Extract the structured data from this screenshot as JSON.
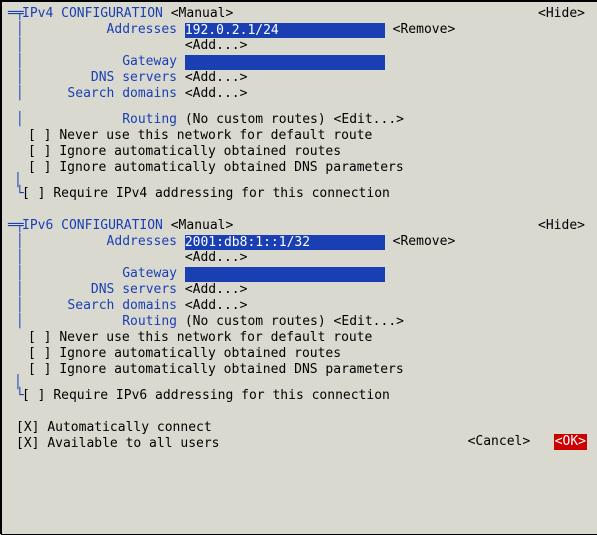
{
  "ipv4": {
    "title": "IPv4 CONFIGURATION",
    "mode": "<Manual>",
    "hide": "<Hide>",
    "addresses_label": "Addresses",
    "address_value": "192.0.2.1/24",
    "remove": "<Remove>",
    "add": "<Add...>",
    "gateway_label": "Gateway",
    "gateway_value": "",
    "dns_label": "DNS servers",
    "search_label": "Search domains",
    "routing_label": "Routing",
    "routing_status": "(No custom routes)",
    "edit": "<Edit...>",
    "cb_never": "Never use this network for default route",
    "cb_ignore_routes": "Ignore automatically obtained routes",
    "cb_ignore_dns": "Ignore automatically obtained DNS parameters",
    "cb_require": "Require IPv4 addressing for this connection"
  },
  "ipv6": {
    "title": "IPv6 CONFIGURATION",
    "mode": "<Manual>",
    "hide": "<Hide>",
    "addresses_label": "Addresses",
    "address_value": "2001:db8:1::1/32",
    "remove": "<Remove>",
    "add": "<Add...>",
    "gateway_label": "Gateway",
    "gateway_value": "",
    "dns_label": "DNS servers",
    "search_label": "Search domains",
    "routing_label": "Routing",
    "routing_status": "(No custom routes)",
    "edit": "<Edit...>",
    "cb_never": "Never use this network for default route",
    "cb_ignore_routes": "Ignore automatically obtained routes",
    "cb_ignore_dns": "Ignore automatically obtained DNS parameters",
    "cb_require": "Require IPv6 addressing for this connection"
  },
  "global": {
    "auto_connect": "Automatically connect",
    "all_users": "Available to all users",
    "cancel": "<Cancel>",
    "ok": "<OK>"
  },
  "marks": {
    "unchecked": "[ ]",
    "checked": "[X]"
  }
}
